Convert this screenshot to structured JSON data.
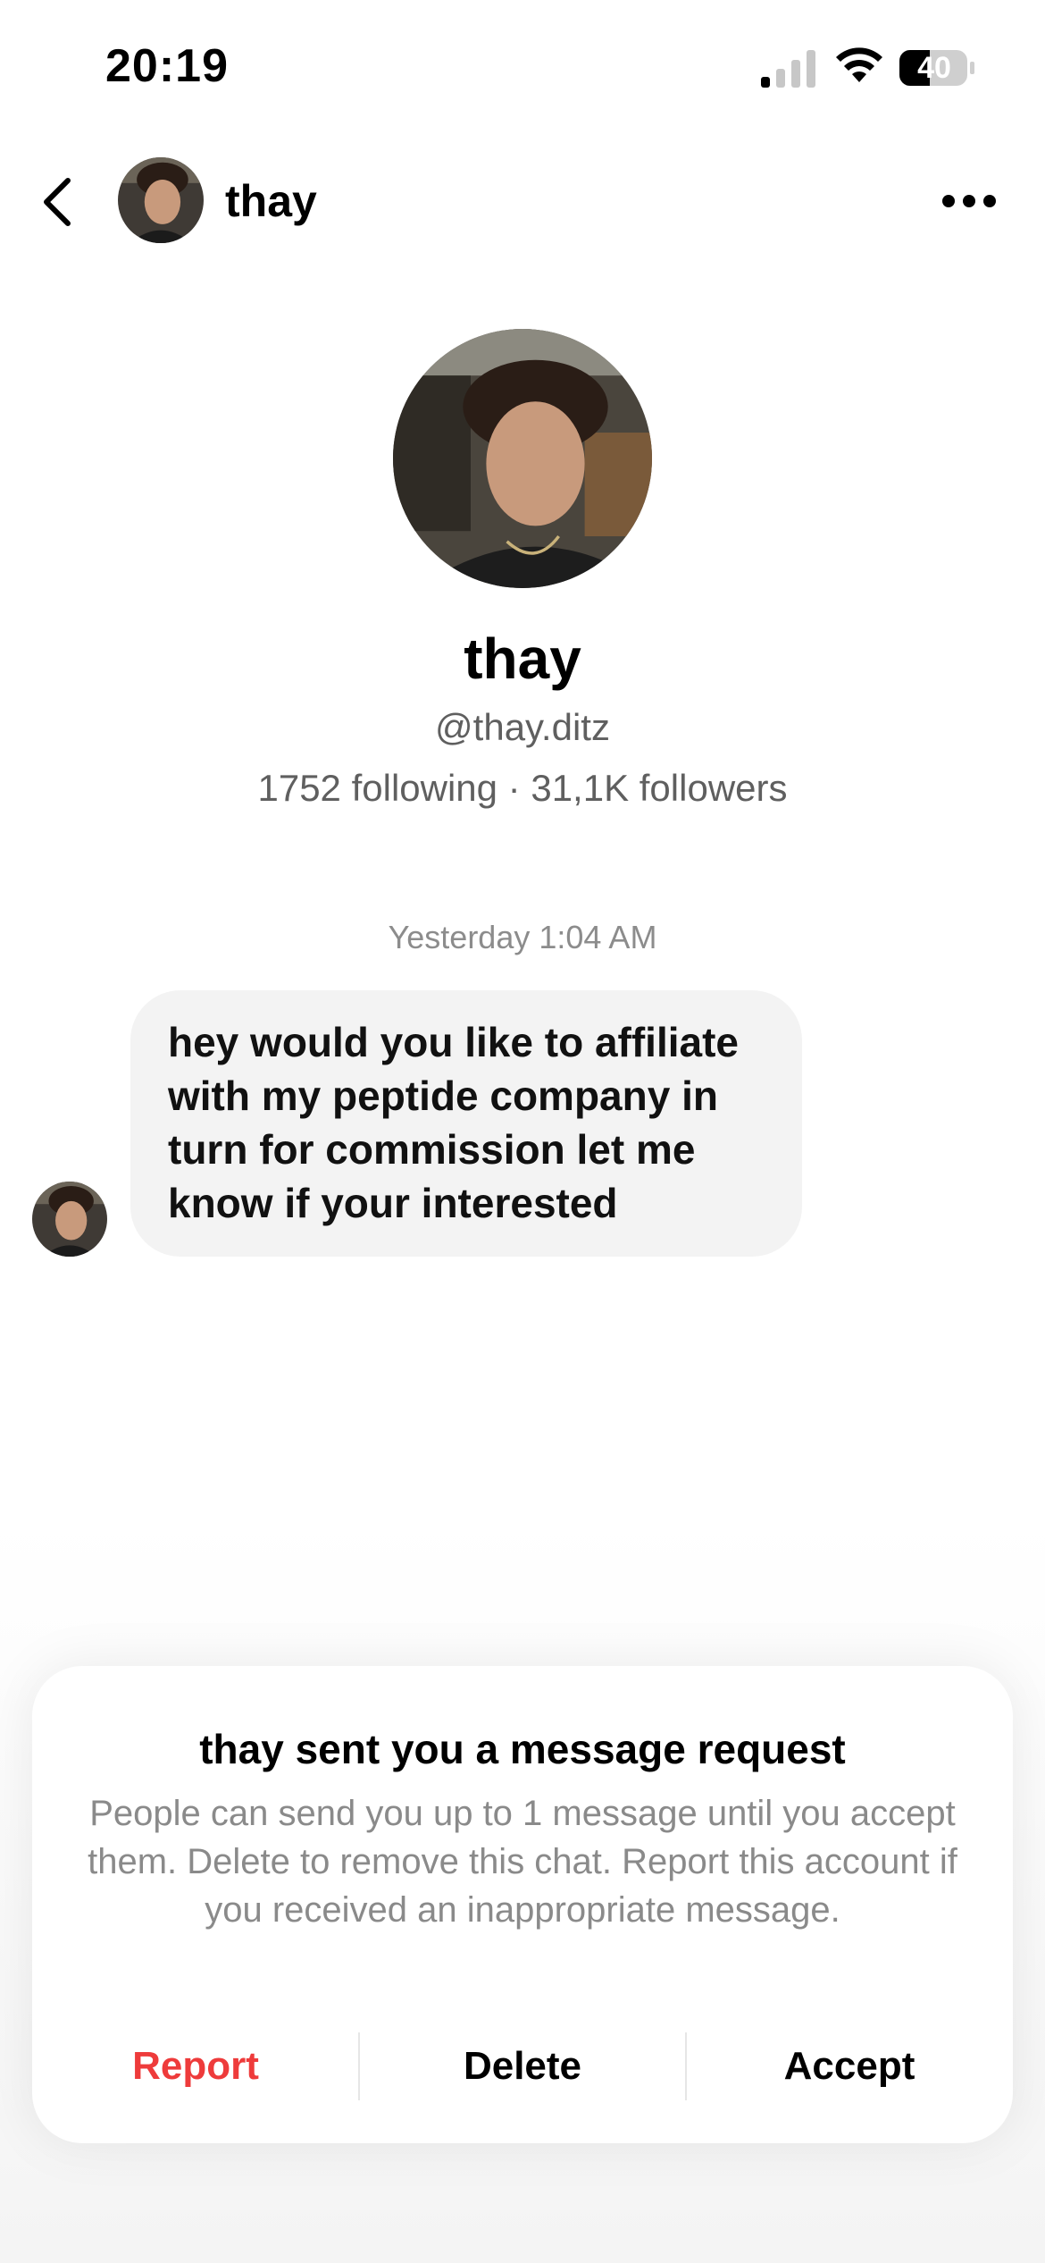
{
  "status_bar": {
    "time": "20:19",
    "battery_level": "40",
    "icons": [
      "signal-icon",
      "wifi-icon",
      "battery-icon"
    ]
  },
  "header": {
    "name": "thay",
    "icons": [
      "back-chevron-icon",
      "more-options-icon"
    ]
  },
  "profile": {
    "name": "thay",
    "handle": "@thay.ditz",
    "stats": "1752 following · 31,1K followers"
  },
  "conversation": {
    "timestamp": "Yesterday 1:04 AM",
    "messages": [
      {
        "text": "hey would you like to affiliate with my peptide company in turn for commission let me know if your interested"
      }
    ]
  },
  "request_card": {
    "title": "thay sent you a message request",
    "body": "People can send you up to 1 message until you accept them. Delete to remove this chat. Report this account if you received an inappropriate message.",
    "actions": {
      "report": "Report",
      "delete": "Delete",
      "accept": "Accept"
    },
    "colors": {
      "report": "#ee3b3b",
      "secondary_text": "#8a8a8a"
    }
  }
}
